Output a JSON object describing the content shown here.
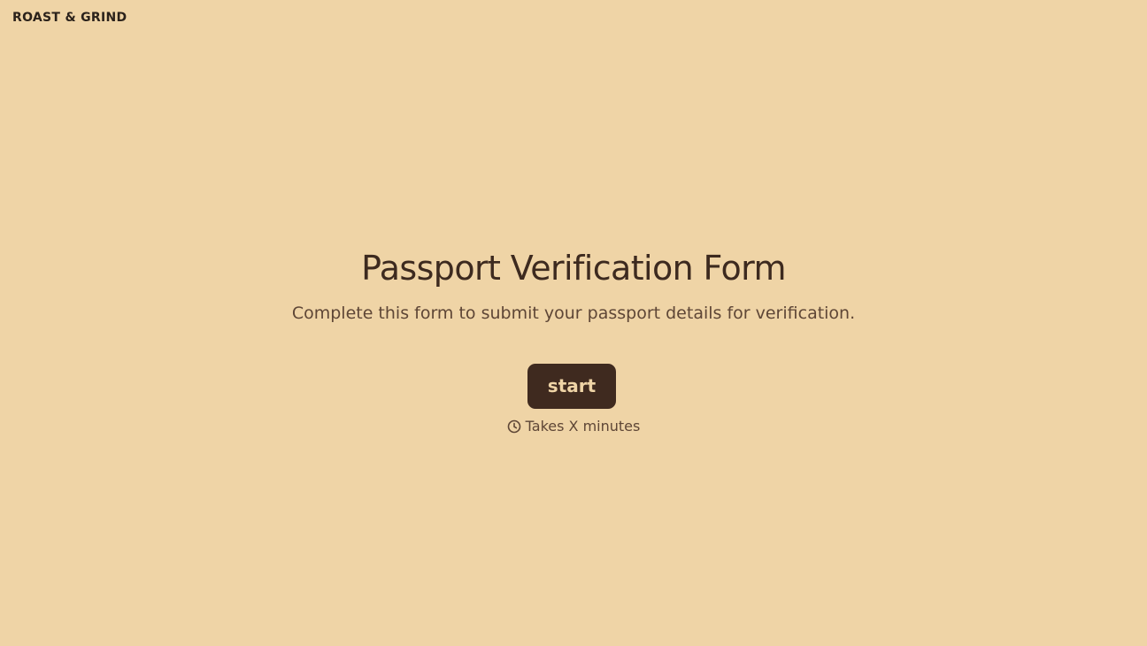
{
  "brand": {
    "logo_text": "ROAST & GRIND"
  },
  "intro": {
    "title": "Passport Verification Form",
    "subtitle": "Complete this form to submit your passport details for verification.",
    "start_label": "start",
    "duration_text": "Takes X minutes",
    "duration_icon": "clock-icon"
  },
  "colors": {
    "background": "#EFD4A6",
    "text_dark": "#3D2A1F",
    "text_muted": "#5E4636",
    "button_bg": "#3F2A1F",
    "button_text": "#EFD4A6"
  }
}
